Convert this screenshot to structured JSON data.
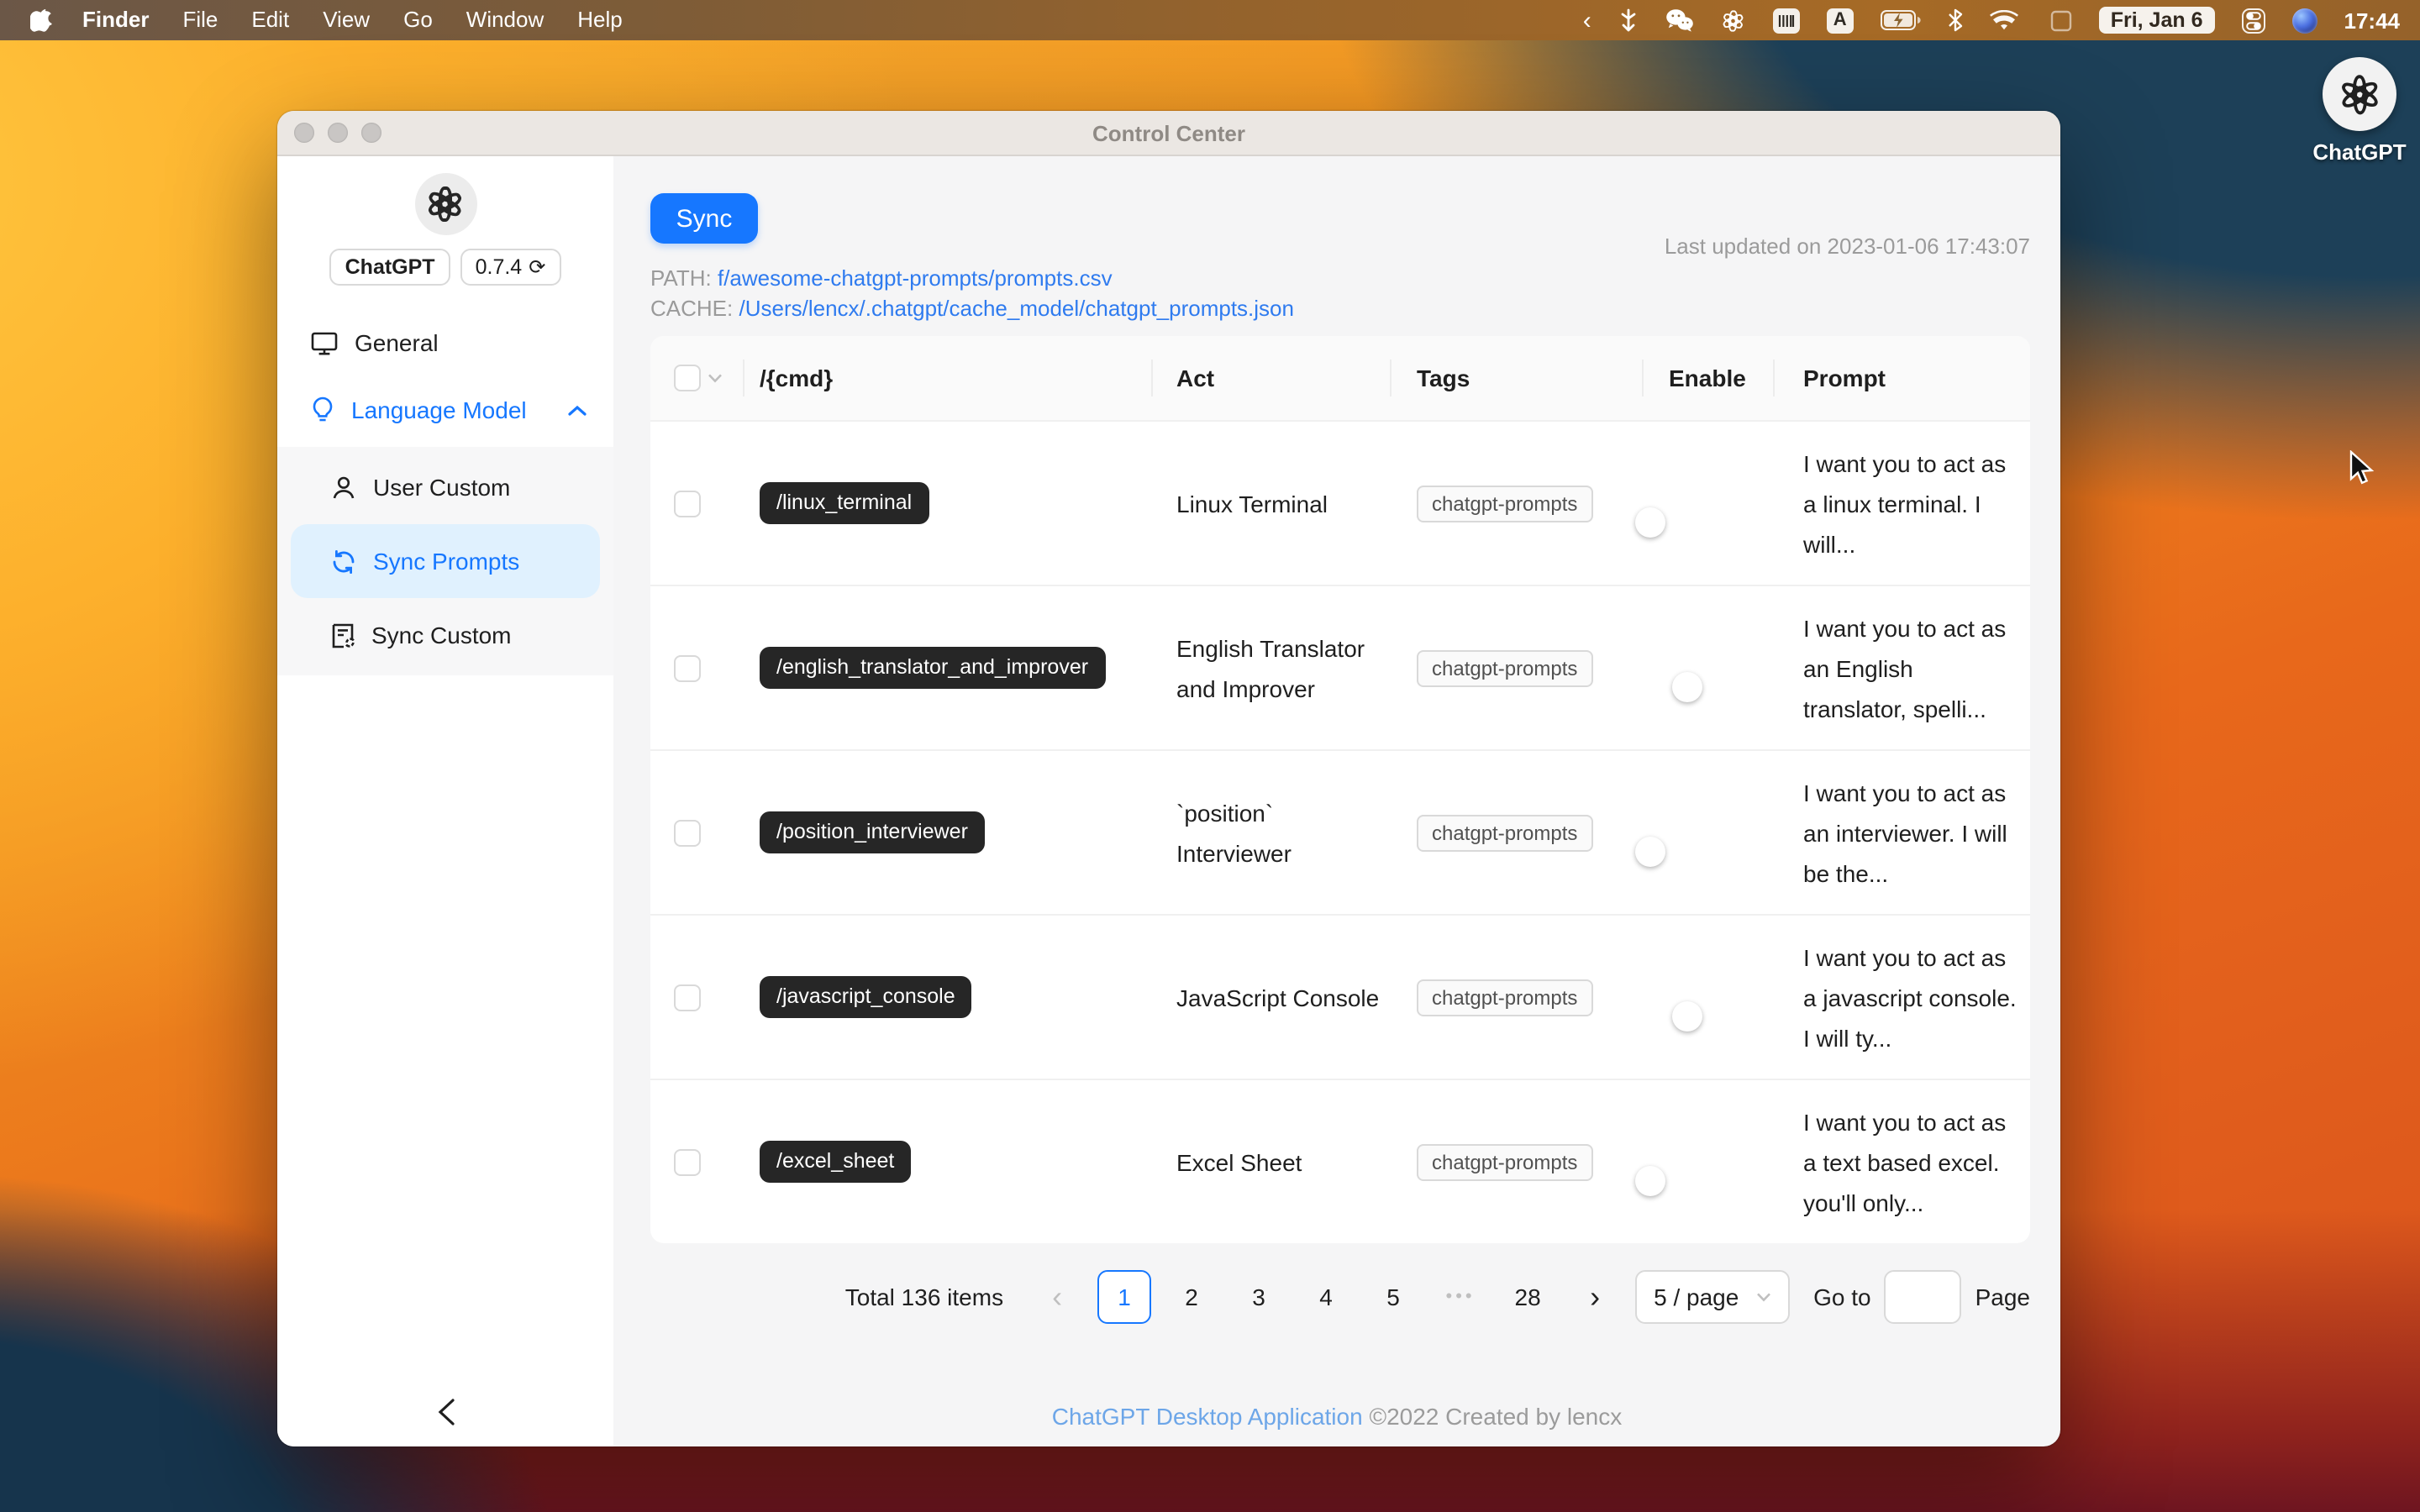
{
  "colors": {
    "accent": "#1677ff",
    "link": "#2f7bef",
    "footer_link": "#6da6e8",
    "toggle_off": "#bfbfbf",
    "cmd_pill_bg": "#262626",
    "selected_item_bg": "#e0f1fe"
  },
  "menu_bar": {
    "items": [
      "Finder",
      "File",
      "Edit",
      "View",
      "Go",
      "Window",
      "Help"
    ],
    "status": {
      "date": "Fri, Jan 6",
      "time": "17:44",
      "input_source": "A"
    }
  },
  "desktop": {
    "chatgpt_icon_label": "ChatGPT"
  },
  "window": {
    "title": "Control Center",
    "sidebar": {
      "app_badge": "ChatGPT",
      "version": "0.7.4",
      "refresh_glyph": "⟳",
      "item_general": "General",
      "item_language_model": "Language Model",
      "item_user_custom": "User Custom",
      "item_sync_prompts": "Sync Prompts",
      "item_sync_custom": "Sync Custom"
    },
    "toolbar": {
      "sync_label": "Sync",
      "path_label": "PATH:",
      "path_value": "f/awesome-chatgpt-prompts/prompts.csv",
      "cache_label": "CACHE:",
      "cache_value": "/Users/lencx/.chatgpt/cache_model/chatgpt_prompts.json",
      "last_updated": "Last updated on 2023-01-06 17:43:07"
    },
    "table": {
      "columns": [
        "/{cmd}",
        "Act",
        "Tags",
        "Enable",
        "Prompt"
      ],
      "rows": [
        {
          "cmd": "/linux_terminal",
          "act": "Linux Terminal",
          "tag": "chatgpt-prompts",
          "enabled": true,
          "prompt": "I want you to act as a linux terminal. I will..."
        },
        {
          "cmd": "/english_translator_and_improver",
          "act": "English Translator and Improver",
          "tag": "chatgpt-prompts",
          "enabled": false,
          "prompt": "I want you to act as an English translator, spelli..."
        },
        {
          "cmd": "/position_interviewer",
          "act": "`position` Interviewer",
          "tag": "chatgpt-prompts",
          "enabled": true,
          "prompt": "I want you to act as an interviewer. I will be the..."
        },
        {
          "cmd": "/javascript_console",
          "act": "JavaScript Console",
          "tag": "chatgpt-prompts",
          "enabled": false,
          "prompt": "I want you to act as a javascript console. I will ty..."
        },
        {
          "cmd": "/excel_sheet",
          "act": "Excel Sheet",
          "tag": "chatgpt-prompts",
          "enabled": true,
          "prompt": "I want you to act as a text based excel. you'll only..."
        }
      ]
    },
    "pagination": {
      "total": "Total 136 items",
      "prev_glyph": "‹",
      "next_glyph": "›",
      "pages": [
        "1",
        "2",
        "3",
        "4",
        "5"
      ],
      "ellipsis": "•••",
      "last_page": "28",
      "page_size": "5 / page",
      "goto_label": "Go to",
      "goto_value": "",
      "page_label": "Page"
    },
    "footer": {
      "link": "ChatGPT Desktop Application",
      "text": "©2022 Created by lencx"
    }
  }
}
